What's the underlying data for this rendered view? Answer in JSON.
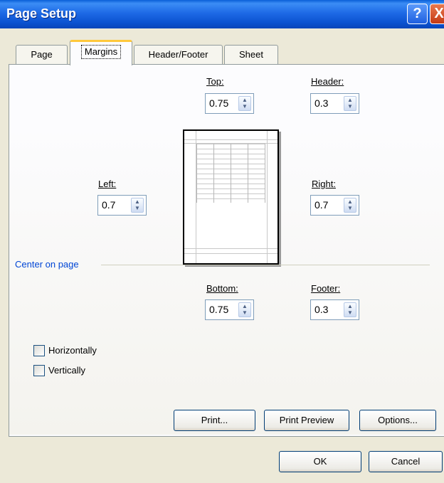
{
  "window": {
    "title": "Page Setup"
  },
  "titlebar": {
    "help_label": "?",
    "close_label": "X"
  },
  "tabs": [
    {
      "label": "Page"
    },
    {
      "label": "Margins"
    },
    {
      "label": "Header/Footer"
    },
    {
      "label": "Sheet"
    }
  ],
  "margins": {
    "top": {
      "label": "Top:",
      "value": "0.75"
    },
    "header": {
      "label": "Header:",
      "value": "0.3"
    },
    "left": {
      "label": "Left:",
      "value": "0.7"
    },
    "right": {
      "label": "Right:",
      "value": "0.7"
    },
    "bottom": {
      "label": "Bottom:",
      "value": "0.75"
    },
    "footer": {
      "label": "Footer:",
      "value": "0.3"
    }
  },
  "center_on_page": {
    "label": "Center on page",
    "horizontally": {
      "label": "Horizontally",
      "checked": false
    },
    "vertically": {
      "label": "Vertically",
      "checked": false
    }
  },
  "buttons": {
    "print": "Print...",
    "print_preview": "Print Preview",
    "options": "Options...",
    "ok": "OK",
    "cancel": "Cancel"
  },
  "icons": {
    "spin": "spinner-arrows-icon",
    "help": "help-icon",
    "close": "close-icon"
  },
  "colors": {
    "titlebar": "#0b52d0",
    "accent_tab": "#ffc83c",
    "section_label": "#0046d5",
    "dialog_bg": "#ece9d8"
  }
}
